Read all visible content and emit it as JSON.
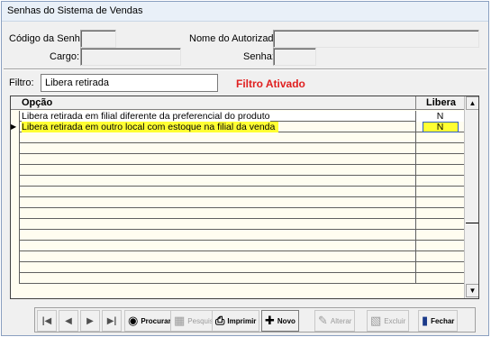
{
  "window": {
    "title": "Senhas do Sistema de Vendas"
  },
  "form": {
    "codigo_label": "Código da Senha:",
    "nome_label": "Nome do Autorizado:",
    "cargo_label": "Cargo:",
    "senha_label": "Senha:"
  },
  "filter": {
    "label": "Filtro:",
    "value": "Libera retirada",
    "status": "Filtro Ativado",
    "status_color": "#e02020"
  },
  "grid": {
    "headers": {
      "opcao": "Opção",
      "libera": "Libera"
    },
    "rows": [
      {
        "opcao": "Libera retirada em filial diferente da preferencial do produto",
        "libera": "N"
      },
      {
        "opcao": "Libera retirada em outro local com estoque na filial da venda",
        "libera": "N"
      }
    ],
    "selected_row": 1,
    "highlight_color": "#ffff33"
  },
  "toolbar": {
    "first_icon": "first-record-icon",
    "prev_icon": "previous-record-icon",
    "next_icon": "next-record-icon",
    "last_icon": "last-record-icon",
    "procurar": "Procurar",
    "pesquisa": "Pesquisa",
    "imprimir": "Imprimir",
    "novo": "Novo",
    "alterar": "Alterar",
    "excluir": "Excluir",
    "fechar": "Fechar"
  }
}
